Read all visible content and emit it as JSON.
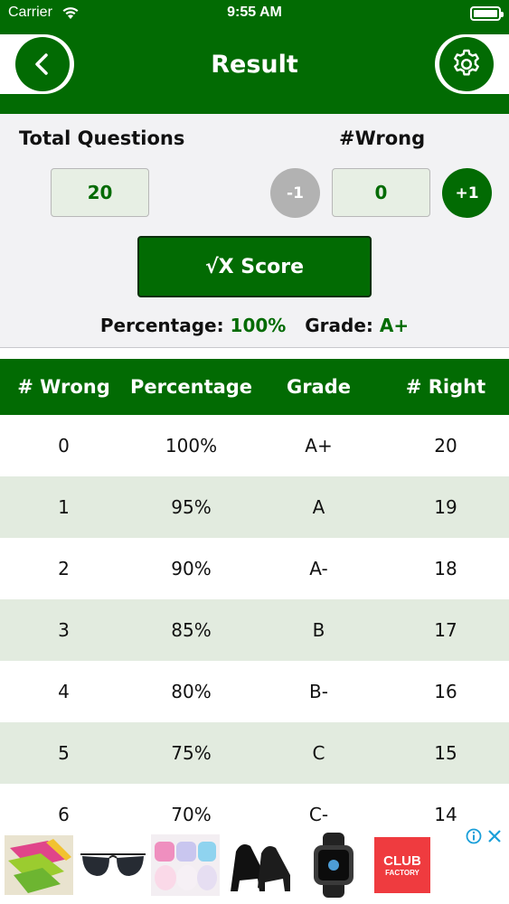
{
  "status_bar": {
    "carrier": "Carrier",
    "time": "9:55 AM"
  },
  "nav": {
    "title": "Result",
    "back_icon": "chevron-left-icon",
    "settings_icon": "gear-icon"
  },
  "controls": {
    "total_label": "Total Questions",
    "total_value": "20",
    "wrong_label": "#Wrong",
    "wrong_value": "0",
    "minus_label": "-1",
    "plus_label": "+1",
    "score_label": "√X Score"
  },
  "result": {
    "percentage_label": "Percentage:",
    "percentage_value": "100%",
    "grade_label": "Grade:",
    "grade_value": "A+"
  },
  "table": {
    "headers": [
      "# Wrong",
      "Percentage",
      "Grade",
      "# Right"
    ],
    "rows": [
      [
        "0",
        "100%",
        "A+",
        "20"
      ],
      [
        "1",
        "95%",
        "A",
        "19"
      ],
      [
        "2",
        "90%",
        "A-",
        "18"
      ],
      [
        "3",
        "85%",
        "B",
        "17"
      ],
      [
        "4",
        "80%",
        "B-",
        "16"
      ],
      [
        "5",
        "75%",
        "C",
        "15"
      ],
      [
        "6",
        "70%",
        "C-",
        "14"
      ]
    ]
  },
  "ad": {
    "brand_line1": "CLUB",
    "brand_line2": "FACTORY"
  },
  "colors": {
    "primary": "#026b03",
    "alt_row": "#e2ebdf",
    "panel": "#f2f2f4",
    "disabled": "#b2b2b2"
  }
}
